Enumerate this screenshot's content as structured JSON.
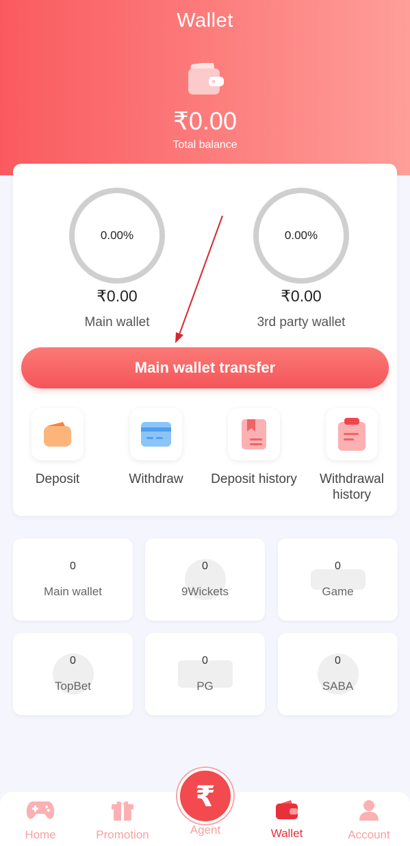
{
  "header": {
    "title": "Wallet",
    "total_amount": "₹0.00",
    "total_label": "Total balance"
  },
  "wallets": {
    "main": {
      "percent": "0.00%",
      "amount": "₹0.00",
      "label": "Main wallet"
    },
    "third_party": {
      "percent": "0.00%",
      "amount": "₹0.00",
      "label": "3rd party wallet"
    }
  },
  "transfer_button": "Main wallet transfer",
  "actions": [
    {
      "label": "Deposit",
      "icon": "deposit-icon"
    },
    {
      "label": "Withdraw",
      "icon": "withdraw-icon"
    },
    {
      "label": "Deposit history",
      "icon": "deposit-history-icon"
    },
    {
      "label": "Withdrawal history",
      "icon": "withdrawal-history-icon"
    }
  ],
  "game_wallets": [
    {
      "value": "0",
      "name": "Main wallet"
    },
    {
      "value": "0",
      "name": "9Wickets"
    },
    {
      "value": "0",
      "name": "Game"
    },
    {
      "value": "0",
      "name": "TopBet"
    },
    {
      "value": "0",
      "name": "PG"
    },
    {
      "value": "0",
      "name": "SABA"
    }
  ],
  "tabbar": {
    "home": "Home",
    "promotion": "Promotion",
    "agent": "Agent",
    "agent_symbol": "₹",
    "wallet": "Wallet",
    "account": "Account"
  },
  "colors": {
    "accent": "#f5555a",
    "header_start": "#fa5a5f",
    "header_end": "#fe9e99",
    "tab_inactive": "#f9a0a0"
  }
}
